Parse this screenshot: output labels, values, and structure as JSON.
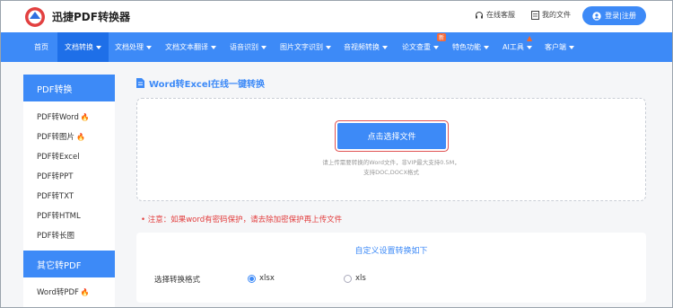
{
  "header": {
    "brand": "迅捷PDF转换器",
    "service_label": "在线客服",
    "files_label": "我的文件",
    "login_label": "登录|注册"
  },
  "nav": {
    "items": [
      {
        "label": "首页",
        "dropdown": false
      },
      {
        "label": "文档转换",
        "dropdown": true,
        "active": true
      },
      {
        "label": "文档处理",
        "dropdown": true
      },
      {
        "label": "文档文本翻译",
        "dropdown": true
      },
      {
        "label": "语音识别",
        "dropdown": true
      },
      {
        "label": "图片文字识别",
        "dropdown": true
      },
      {
        "label": "音视频转换",
        "dropdown": true
      },
      {
        "label": "论文查重",
        "dropdown": true,
        "badge": "新"
      },
      {
        "label": "特色功能",
        "dropdown": true
      },
      {
        "label": "AI工具",
        "dropdown": true
      },
      {
        "label": "客户端",
        "dropdown": true
      }
    ]
  },
  "sidebar": {
    "section1_title": "PDF转换",
    "section1_items": [
      {
        "label": "PDF转Word",
        "hot": true
      },
      {
        "label": "PDF转图片",
        "hot": true
      },
      {
        "label": "PDF转Excel",
        "hot": false
      },
      {
        "label": "PDF转PPT",
        "hot": false
      },
      {
        "label": "PDF转TXT",
        "hot": false
      },
      {
        "label": "PDF转HTML",
        "hot": false
      },
      {
        "label": "PDF转长图",
        "hot": false
      }
    ],
    "section2_title": "其它转PDF",
    "section2_items": [
      {
        "label": "Word转PDF",
        "hot": true
      }
    ]
  },
  "main": {
    "title": "Word转Excel在线一键转换",
    "select_button": "点击选择文件",
    "hint_line1": "请上传需要转换的Word文件，非VIP最大支持0.5M，",
    "hint_line2": "支持DOC,DOCX格式",
    "notice": "• 注意：如果word有密码保护，请去除加密保护再上传文件"
  },
  "settings": {
    "title": "自定义设置转换如下",
    "format_label": "选择转换格式",
    "options": [
      "xlsx",
      "xls"
    ],
    "selected": "xlsx"
  },
  "colors": {
    "primary": "#3d8af7",
    "primary_dark": "#1e6fe8",
    "warning": "#e23c3c",
    "hot": "#f2692e"
  }
}
